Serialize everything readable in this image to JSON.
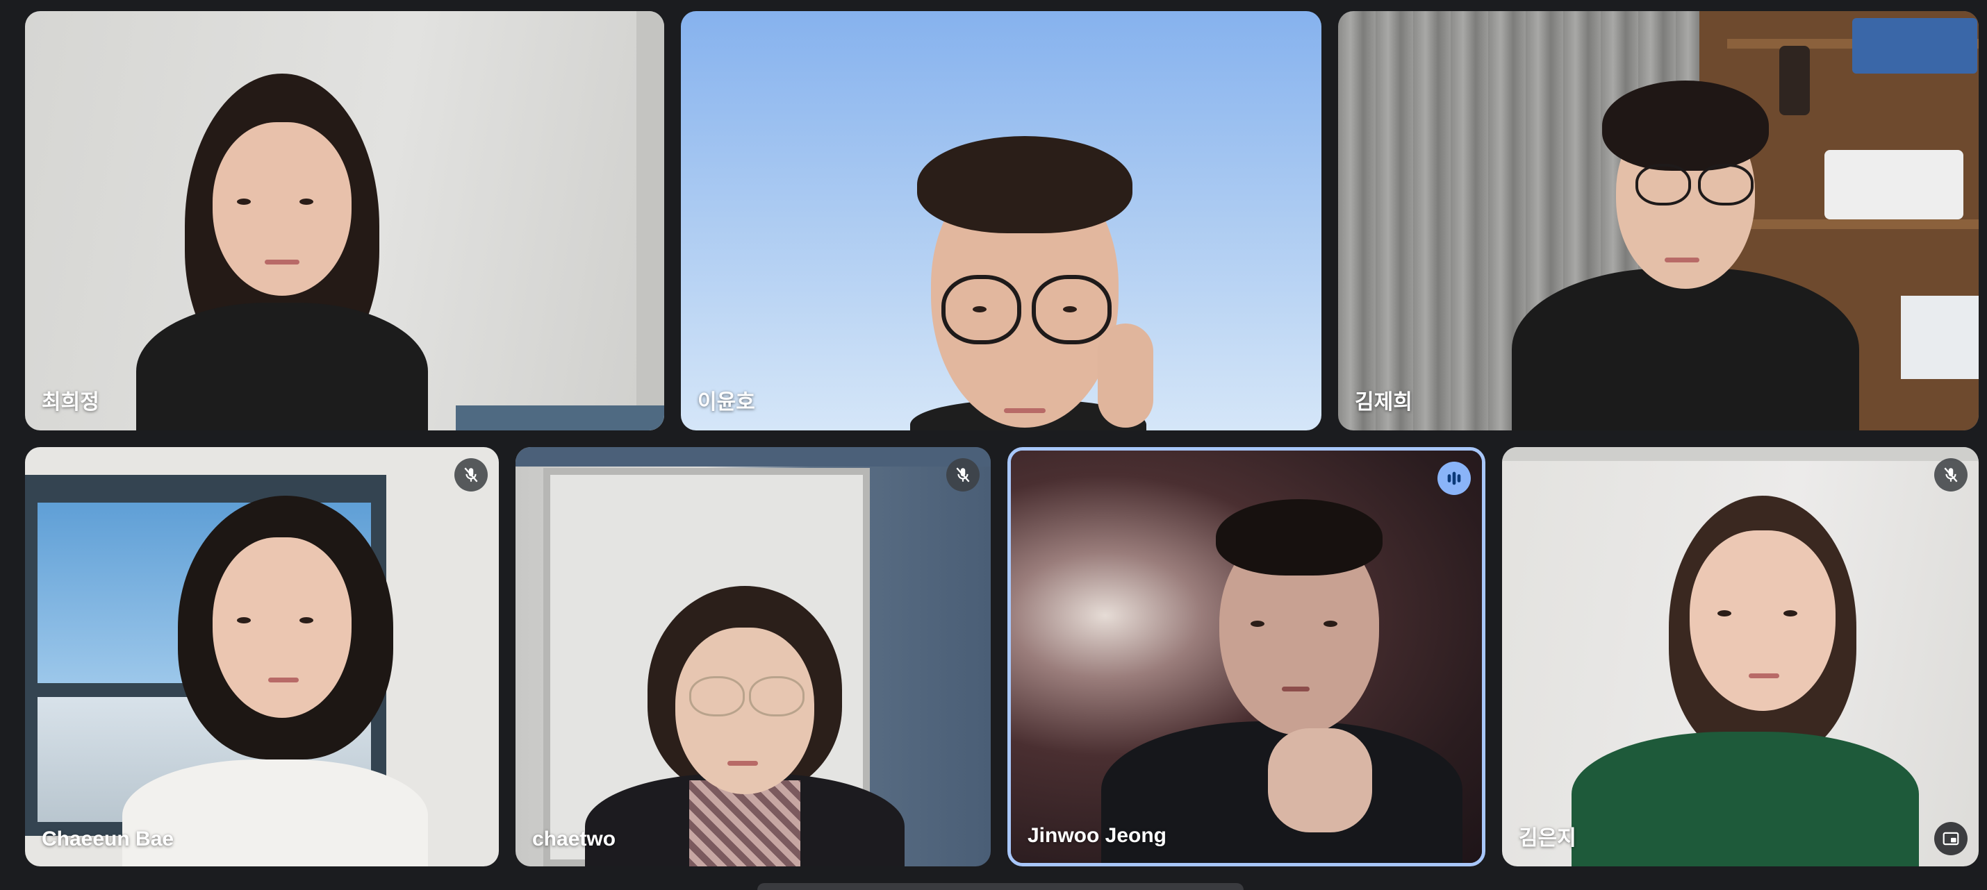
{
  "meeting": {
    "participants": [
      {
        "name": "최희정",
        "muted": false,
        "speaking": false
      },
      {
        "name": "이윤호",
        "muted": false,
        "speaking": false
      },
      {
        "name": "김제희",
        "muted": false,
        "speaking": false
      },
      {
        "name": "Chaeeun Bae",
        "muted": true,
        "speaking": false
      },
      {
        "name": "chaetwo",
        "muted": true,
        "speaking": false
      },
      {
        "name": "Jinwoo Jeong",
        "muted": false,
        "speaking": true
      },
      {
        "name": "김은지",
        "muted": true,
        "speaking": false
      }
    ],
    "icons": {
      "mic_off": "mic-off-icon",
      "speaking": "audio-level-icon",
      "pip": "picture-in-picture-icon"
    },
    "colors": {
      "background": "#1b1c1f",
      "active_speaker_border": "#a8c7fa",
      "speaking_badge": "#8ab4f8",
      "badge": "#3c4043"
    }
  }
}
